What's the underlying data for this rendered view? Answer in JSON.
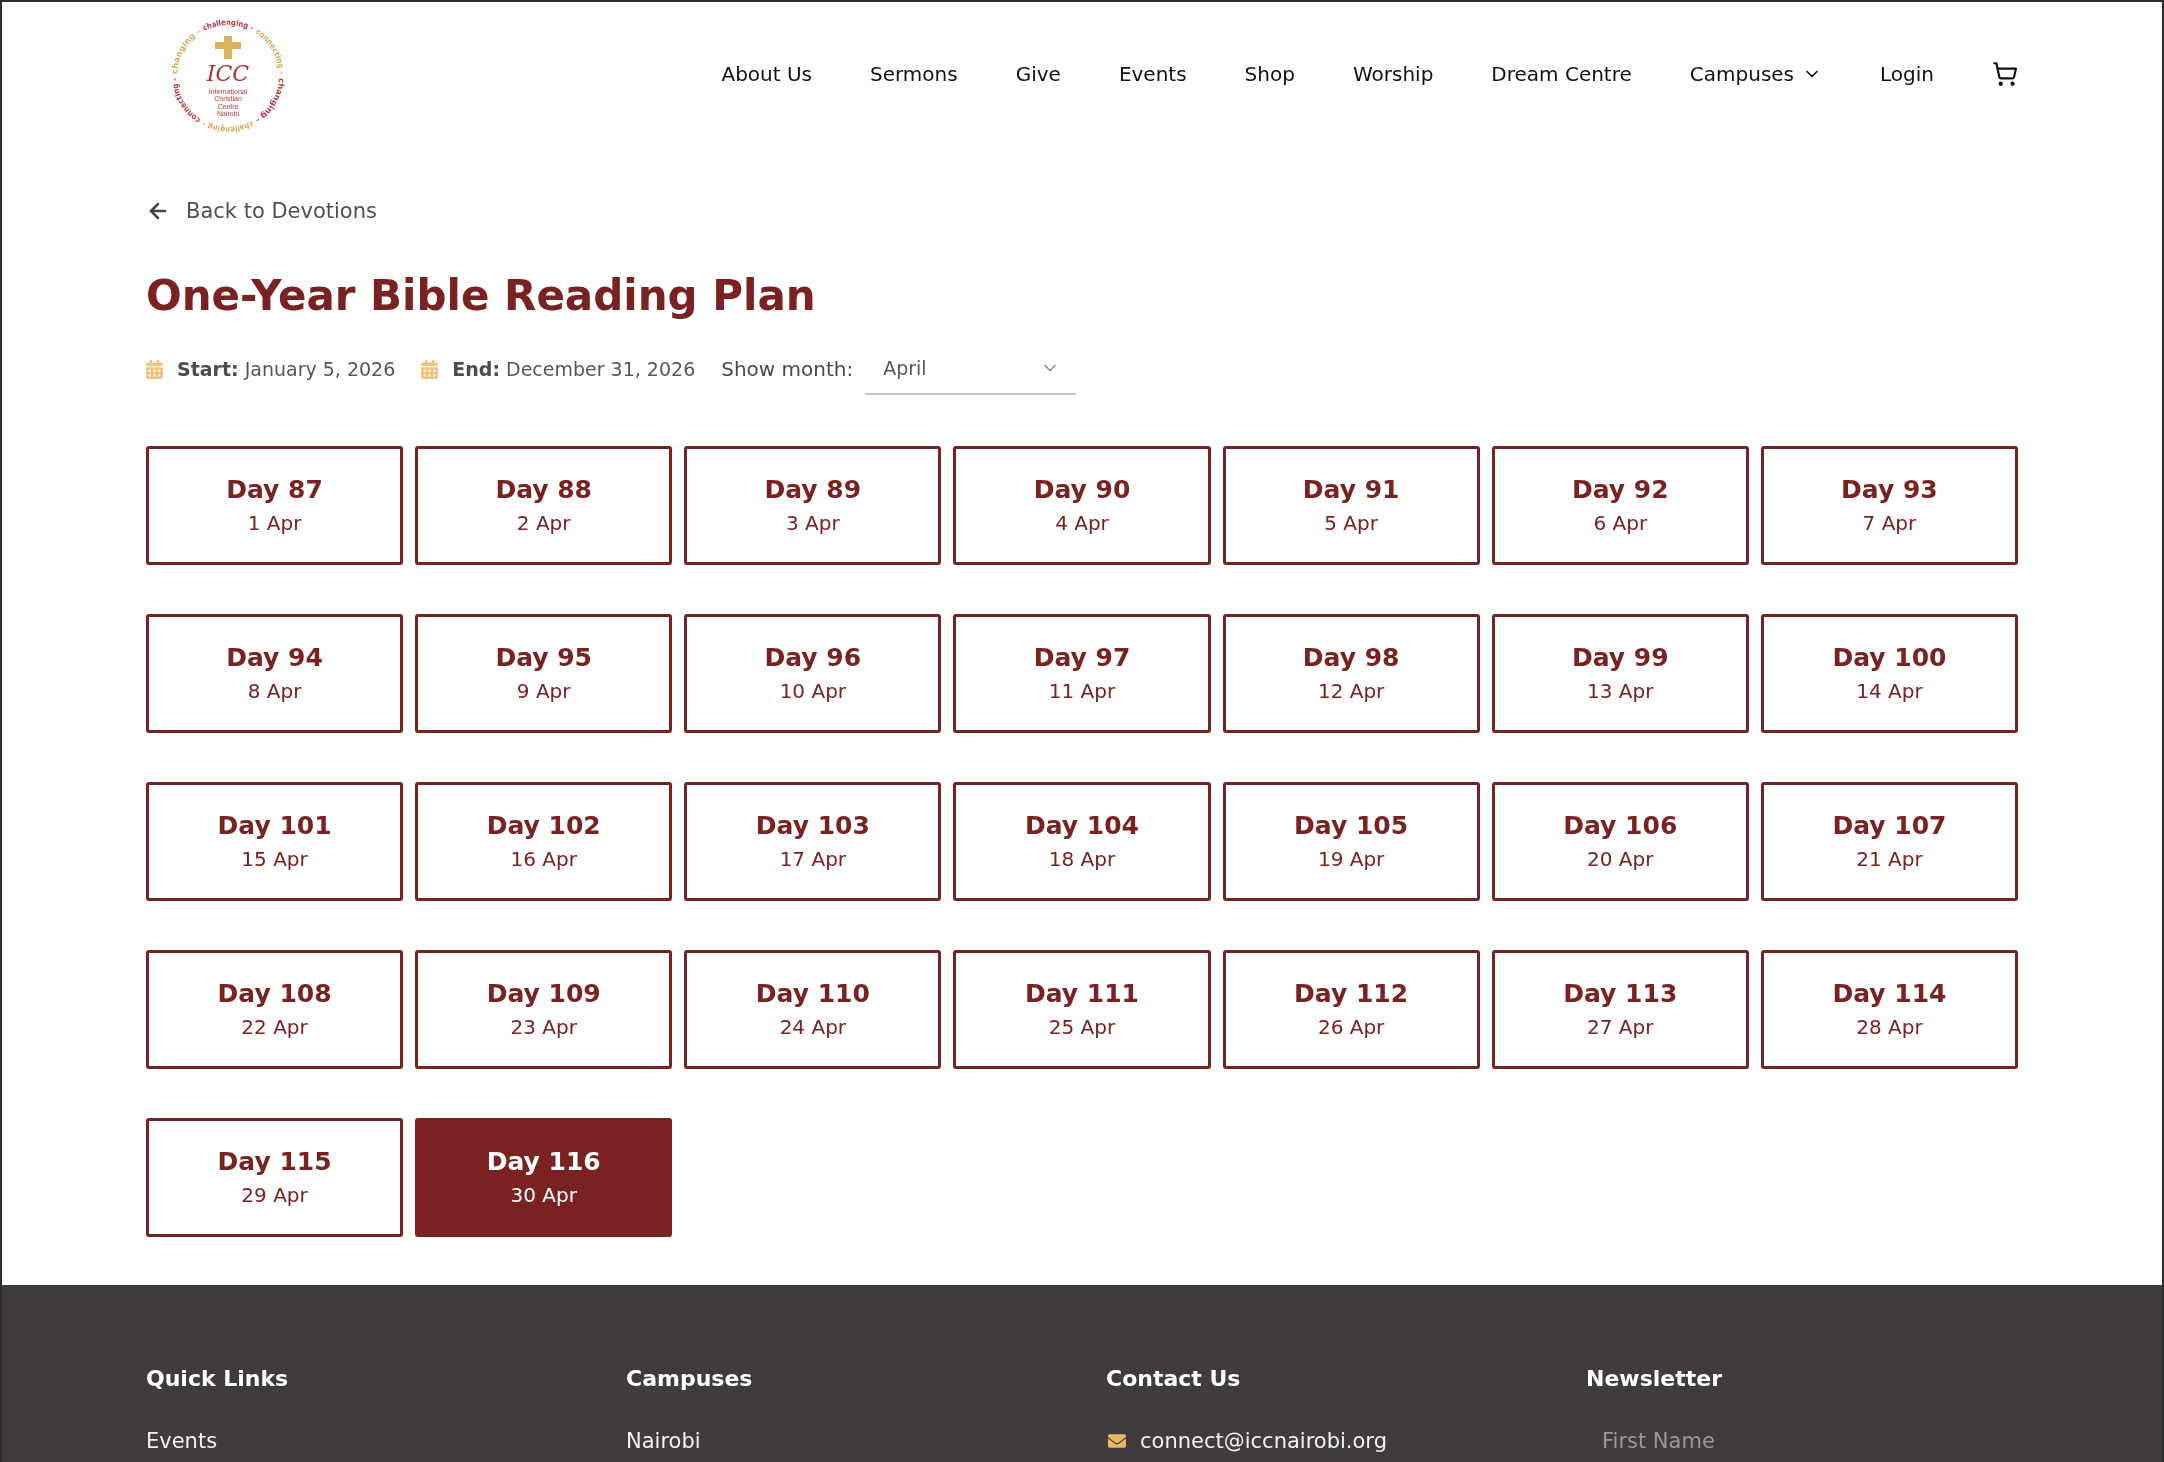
{
  "header": {
    "logo": {
      "ring_words": [
        {
          "text": "challenging",
          "color": "#b83a3f"
        },
        {
          "text": "changing",
          "color": "#d4ad5a"
        },
        {
          "text": "connecting",
          "color": "#d4ad5a"
        },
        {
          "text": "connecting",
          "color": "#b83a3f"
        },
        {
          "text": "changing",
          "color": "#b83a3f"
        },
        {
          "text": "challenging",
          "color": "#d4ad5a"
        }
      ],
      "ring_separator": "-",
      "monogram": "ICC",
      "tagline": "International Christian Centre",
      "city": "Nairobi"
    },
    "nav": [
      {
        "label": "About Us",
        "kind": "link"
      },
      {
        "label": "Sermons",
        "kind": "link"
      },
      {
        "label": "Give",
        "kind": "link"
      },
      {
        "label": "Events",
        "kind": "link"
      },
      {
        "label": "Shop",
        "kind": "link"
      },
      {
        "label": "Worship",
        "kind": "link"
      },
      {
        "label": "Dream Centre",
        "kind": "link"
      },
      {
        "label": "Campuses",
        "kind": "dropdown"
      },
      {
        "label": "Login",
        "kind": "link"
      }
    ]
  },
  "back_link": {
    "label": "Back to Devotions"
  },
  "title": "One-Year Bible Reading Plan",
  "plan_dates": [
    {
      "label": "Start:",
      "value": "January 5, 2026"
    },
    {
      "label": "End:",
      "value": "December 31, 2026"
    }
  ],
  "month_filter": {
    "label": "Show month:",
    "value": "April"
  },
  "days": [
    {
      "day": "Day 87",
      "date": "1 Apr",
      "selected": false
    },
    {
      "day": "Day 88",
      "date": "2 Apr",
      "selected": false
    },
    {
      "day": "Day 89",
      "date": "3 Apr",
      "selected": false
    },
    {
      "day": "Day 90",
      "date": "4 Apr",
      "selected": false
    },
    {
      "day": "Day 91",
      "date": "5 Apr",
      "selected": false
    },
    {
      "day": "Day 92",
      "date": "6 Apr",
      "selected": false
    },
    {
      "day": "Day 93",
      "date": "7 Apr",
      "selected": false
    },
    {
      "day": "Day 94",
      "date": "8 Apr",
      "selected": false
    },
    {
      "day": "Day 95",
      "date": "9 Apr",
      "selected": false
    },
    {
      "day": "Day 96",
      "date": "10 Apr",
      "selected": false
    },
    {
      "day": "Day 97",
      "date": "11 Apr",
      "selected": false
    },
    {
      "day": "Day 98",
      "date": "12 Apr",
      "selected": false
    },
    {
      "day": "Day 99",
      "date": "13 Apr",
      "selected": false
    },
    {
      "day": "Day 100",
      "date": "14 Apr",
      "selected": false
    },
    {
      "day": "Day 101",
      "date": "15 Apr",
      "selected": false
    },
    {
      "day": "Day 102",
      "date": "16 Apr",
      "selected": false
    },
    {
      "day": "Day 103",
      "date": "17 Apr",
      "selected": false
    },
    {
      "day": "Day 104",
      "date": "18 Apr",
      "selected": false
    },
    {
      "day": "Day 105",
      "date": "19 Apr",
      "selected": false
    },
    {
      "day": "Day 106",
      "date": "20 Apr",
      "selected": false
    },
    {
      "day": "Day 107",
      "date": "21 Apr",
      "selected": false
    },
    {
      "day": "Day 108",
      "date": "22 Apr",
      "selected": false
    },
    {
      "day": "Day 109",
      "date": "23 Apr",
      "selected": false
    },
    {
      "day": "Day 110",
      "date": "24 Apr",
      "selected": false
    },
    {
      "day": "Day 111",
      "date": "25 Apr",
      "selected": false
    },
    {
      "day": "Day 112",
      "date": "26 Apr",
      "selected": false
    },
    {
      "day": "Day 113",
      "date": "27 Apr",
      "selected": false
    },
    {
      "day": "Day 114",
      "date": "28 Apr",
      "selected": false
    },
    {
      "day": "Day 115",
      "date": "29 Apr",
      "selected": false
    },
    {
      "day": "Day 116",
      "date": "30 Apr",
      "selected": true
    }
  ],
  "footer": {
    "quick_links": {
      "heading": "Quick Links",
      "links": [
        "Events"
      ]
    },
    "campuses": {
      "heading": "Campuses",
      "links": [
        "Nairobi"
      ]
    },
    "contact": {
      "heading": "Contact Us",
      "email": "connect@iccnairobi.org"
    },
    "newsletter": {
      "heading": "Newsletter",
      "first_name": {
        "placeholder": "First Name"
      }
    }
  }
}
